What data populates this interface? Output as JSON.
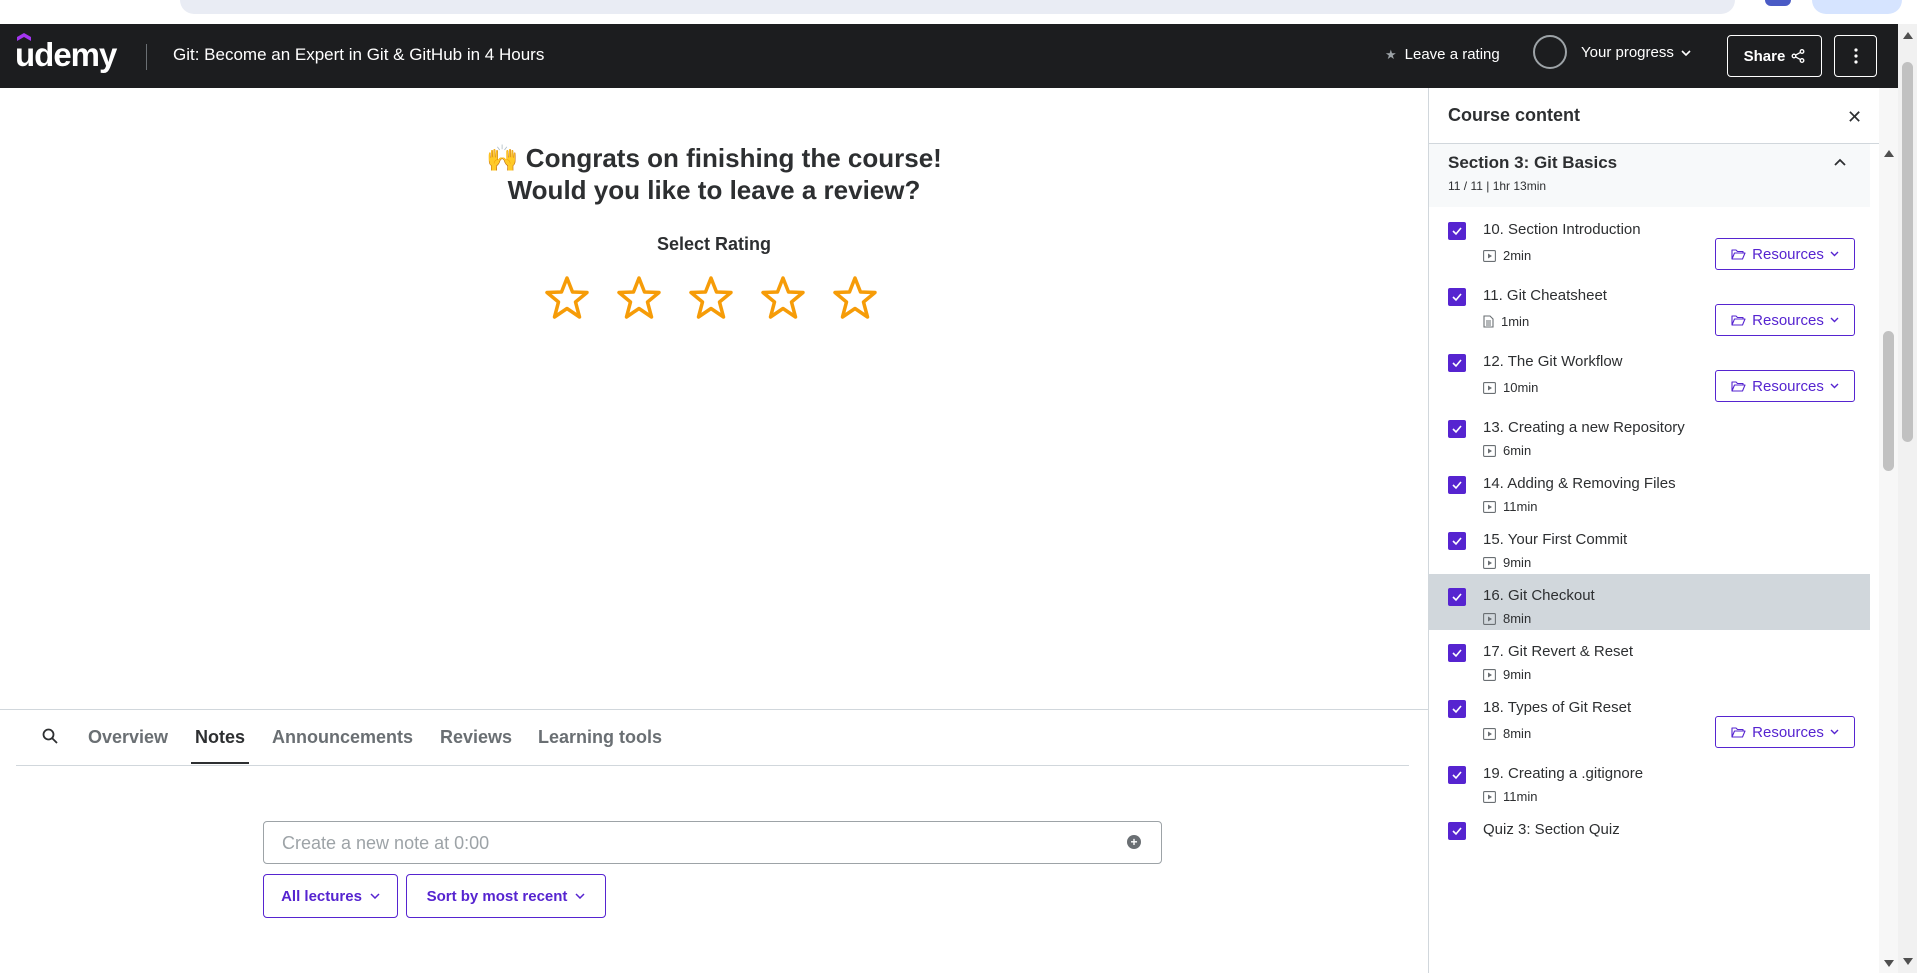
{
  "header": {
    "logo": "udemy",
    "course_title": "Git: Become an Expert in Git & GitHub in 4 Hours",
    "leave_rating": "Leave a rating",
    "your_progress": "Your progress",
    "share": "Share"
  },
  "review": {
    "emoji": "🙌",
    "title_line1": "Congrats on finishing the course!",
    "title_line2": "Would you like to leave a review?",
    "select_rating": "Select Rating",
    "star_color": "#f69c08"
  },
  "tabs": {
    "items": [
      "Overview",
      "Notes",
      "Announcements",
      "Reviews",
      "Learning tools"
    ],
    "active": "Notes"
  },
  "notes": {
    "placeholder": "Create a new note at 0:00",
    "filter_lectures": "All lectures",
    "filter_sort": "Sort by most recent"
  },
  "sidebar": {
    "title": "Course content",
    "section_title": "Section 3: Git Basics",
    "section_meta": "11 / 11 | 1hr 13min",
    "resources_label": "Resources",
    "lectures": [
      {
        "title": "10. Section Introduction",
        "duration": "2min",
        "icon": "video-icon",
        "resources": true
      },
      {
        "title": "11. Git Cheatsheet",
        "duration": "1min",
        "icon": "file-icon",
        "resources": true
      },
      {
        "title": "12. The Git Workflow",
        "duration": "10min",
        "icon": "video-icon",
        "resources": true
      },
      {
        "title": "13. Creating a new Repository",
        "duration": "6min",
        "icon": "video-icon",
        "resources": false
      },
      {
        "title": "14. Adding & Removing Files",
        "duration": "11min",
        "icon": "video-icon",
        "resources": false
      },
      {
        "title": "15. Your First Commit",
        "duration": "9min",
        "icon": "video-icon",
        "resources": false
      },
      {
        "title": "16. Git Checkout",
        "duration": "8min",
        "icon": "video-icon",
        "resources": false,
        "current": true
      },
      {
        "title": "17. Git Revert & Reset",
        "duration": "9min",
        "icon": "video-icon",
        "resources": false
      },
      {
        "title": "18. Types of Git Reset",
        "duration": "8min",
        "icon": "video-icon",
        "resources": true
      },
      {
        "title": "19. Creating a .gitignore",
        "duration": "11min",
        "icon": "video-icon",
        "resources": false
      },
      {
        "title": "Quiz 3: Section Quiz",
        "duration": "",
        "icon": "",
        "resources": false
      }
    ]
  },
  "colors": {
    "brand": "#5624d0",
    "header_bg": "#1c1d1f",
    "current_row": "#d1d7dc"
  }
}
